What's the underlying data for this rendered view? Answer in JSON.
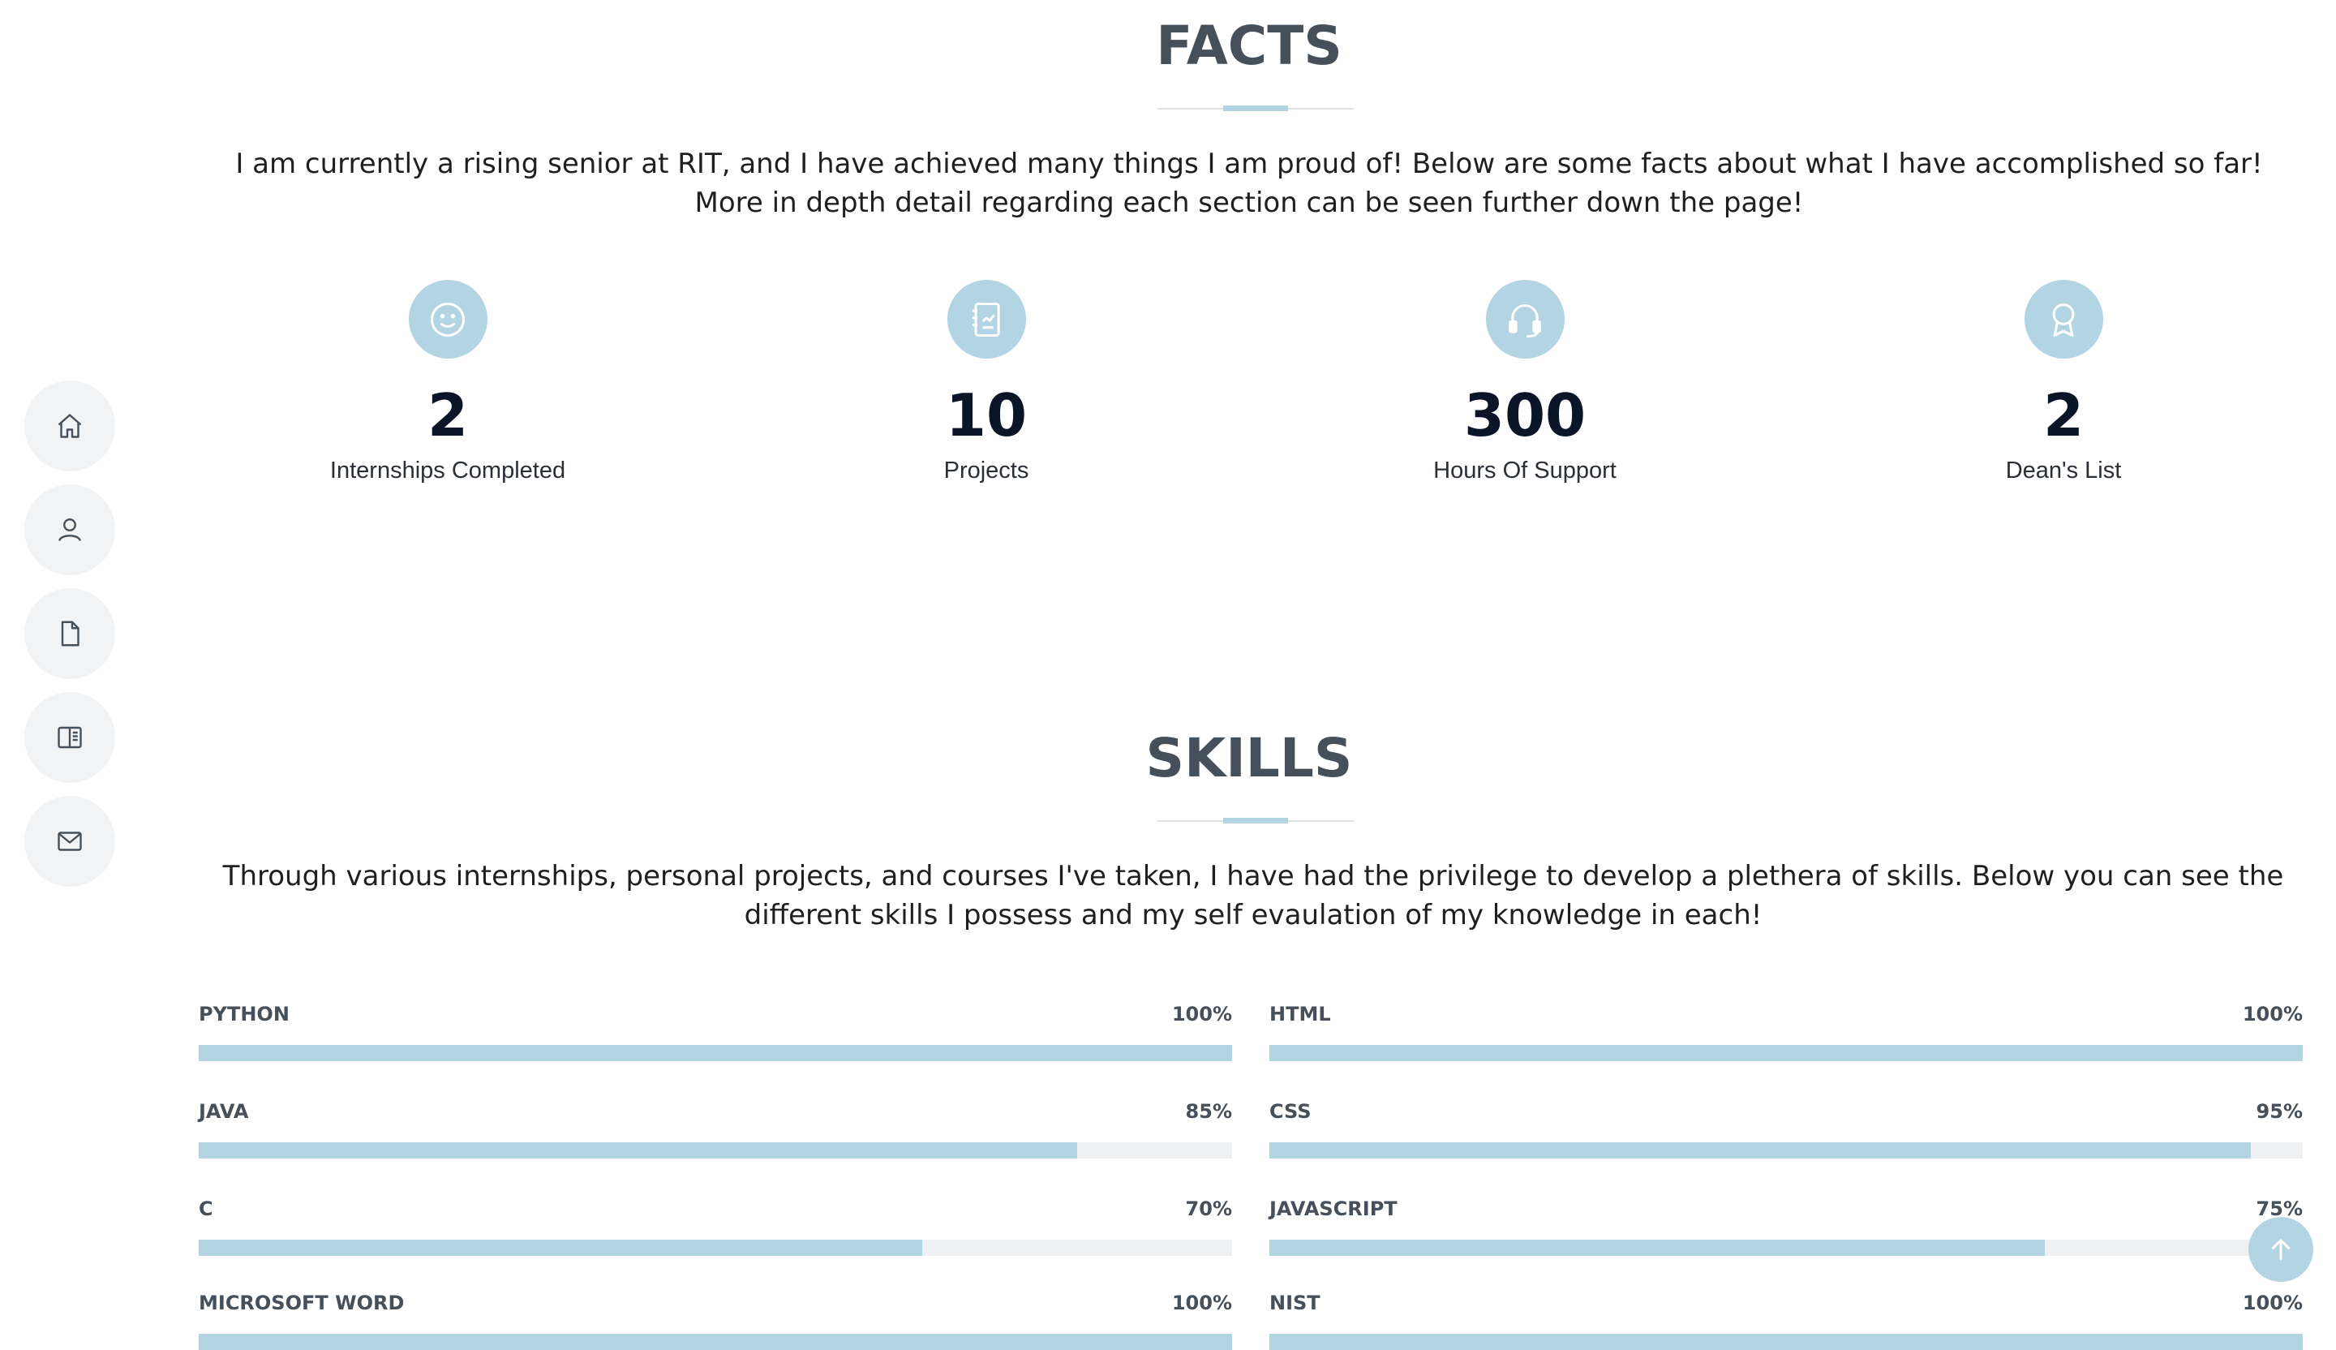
{
  "nav": {
    "items": [
      {
        "icon": "home-icon",
        "name": "Home"
      },
      {
        "icon": "person-icon",
        "name": "About"
      },
      {
        "icon": "file-icon",
        "name": "Resume"
      },
      {
        "icon": "book-icon",
        "name": "Portfolio"
      },
      {
        "icon": "envelope-icon",
        "name": "Contact"
      }
    ]
  },
  "facts": {
    "title": "FACTS",
    "description": "I am currently a rising senior at RIT, and I have achieved many things I am proud of! Below are some facts about what I have accomplished so far! More in depth detail regarding each section can be seen further down the page!",
    "items": [
      {
        "icon": "smiley-icon",
        "number": "2",
        "label": "Internships Completed"
      },
      {
        "icon": "journal-icon",
        "number": "10",
        "label": "Projects"
      },
      {
        "icon": "headset-icon",
        "number": "300",
        "label": "Hours Of Support"
      },
      {
        "icon": "award-icon",
        "number": "2",
        "label": "Dean's List"
      }
    ]
  },
  "skills": {
    "title": "SKILLS",
    "description": "Through various internships, personal projects, and courses I've taken, I have had the privilege to develop a plethera of skills. Below you can see the different skills I possess and my self evaulation of my knowledge in each!",
    "left": [
      {
        "name": "PYTHON",
        "value": "100%",
        "percent": 100
      },
      {
        "name": "JAVA",
        "value": "85%",
        "percent": 85
      },
      {
        "name": "C",
        "value": "70%",
        "percent": 70
      },
      {
        "name": "MICROSOFT WORD",
        "value": "100%",
        "percent": 100
      }
    ],
    "right": [
      {
        "name": "HTML",
        "value": "100%",
        "percent": 100
      },
      {
        "name": "CSS",
        "value": "95%",
        "percent": 95
      },
      {
        "name": "JAVASCRIPT",
        "value": "75%",
        "percent": 75
      },
      {
        "name": "NIST",
        "value": "100%",
        "percent": 100
      }
    ]
  },
  "colors": {
    "accent": "#b3d4e2",
    "title": "#45505b",
    "bar_track": "#eef0f2"
  }
}
